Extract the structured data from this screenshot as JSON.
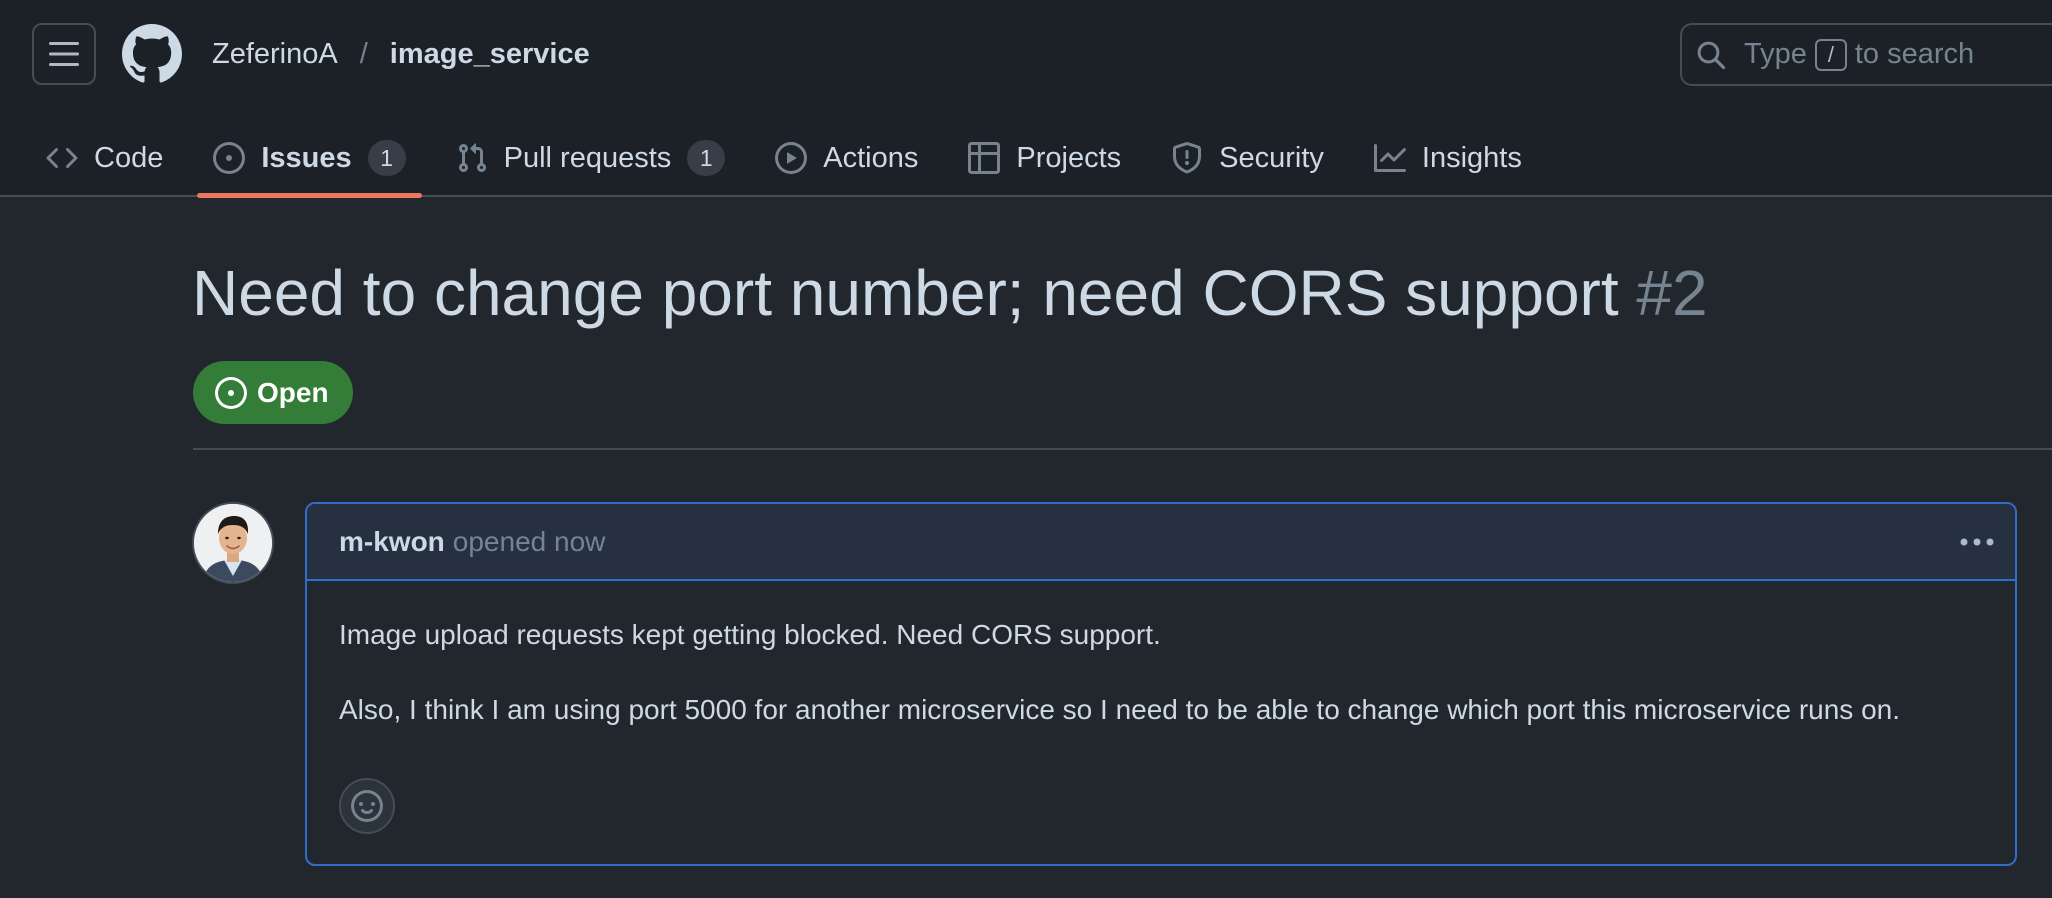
{
  "header": {
    "owner": "ZeferinoA",
    "separator": "/",
    "repo": "image_service",
    "search": {
      "prefix": "Type",
      "key": "/",
      "suffix": "to search"
    }
  },
  "tabs": [
    {
      "label": "Code",
      "icon": "code-icon",
      "selected": false
    },
    {
      "label": "Issues",
      "icon": "issue-opened-icon",
      "selected": true,
      "count": "1"
    },
    {
      "label": "Pull requests",
      "icon": "pull-request-icon",
      "selected": false,
      "count": "1"
    },
    {
      "label": "Actions",
      "icon": "play-icon",
      "selected": false
    },
    {
      "label": "Projects",
      "icon": "table-icon",
      "selected": false
    },
    {
      "label": "Security",
      "icon": "shield-icon",
      "selected": false
    },
    {
      "label": "Insights",
      "icon": "graph-icon",
      "selected": false
    }
  ],
  "issue": {
    "title": "Need to change port number; need CORS support",
    "number": "#2",
    "state": "Open",
    "state_color": "#347d39"
  },
  "comment": {
    "author": "m-kwon",
    "action": "opened now",
    "paragraphs": [
      "Image upload requests kept getting blocked. Need CORS support.",
      "Also, I think I am using port 5000 for another microservice so I need to be able to change which port this microservice runs on."
    ]
  },
  "colors": {
    "accent_tab_underline": "#ec775c",
    "comment_border": "#316dca",
    "open_badge": "#347d39"
  }
}
